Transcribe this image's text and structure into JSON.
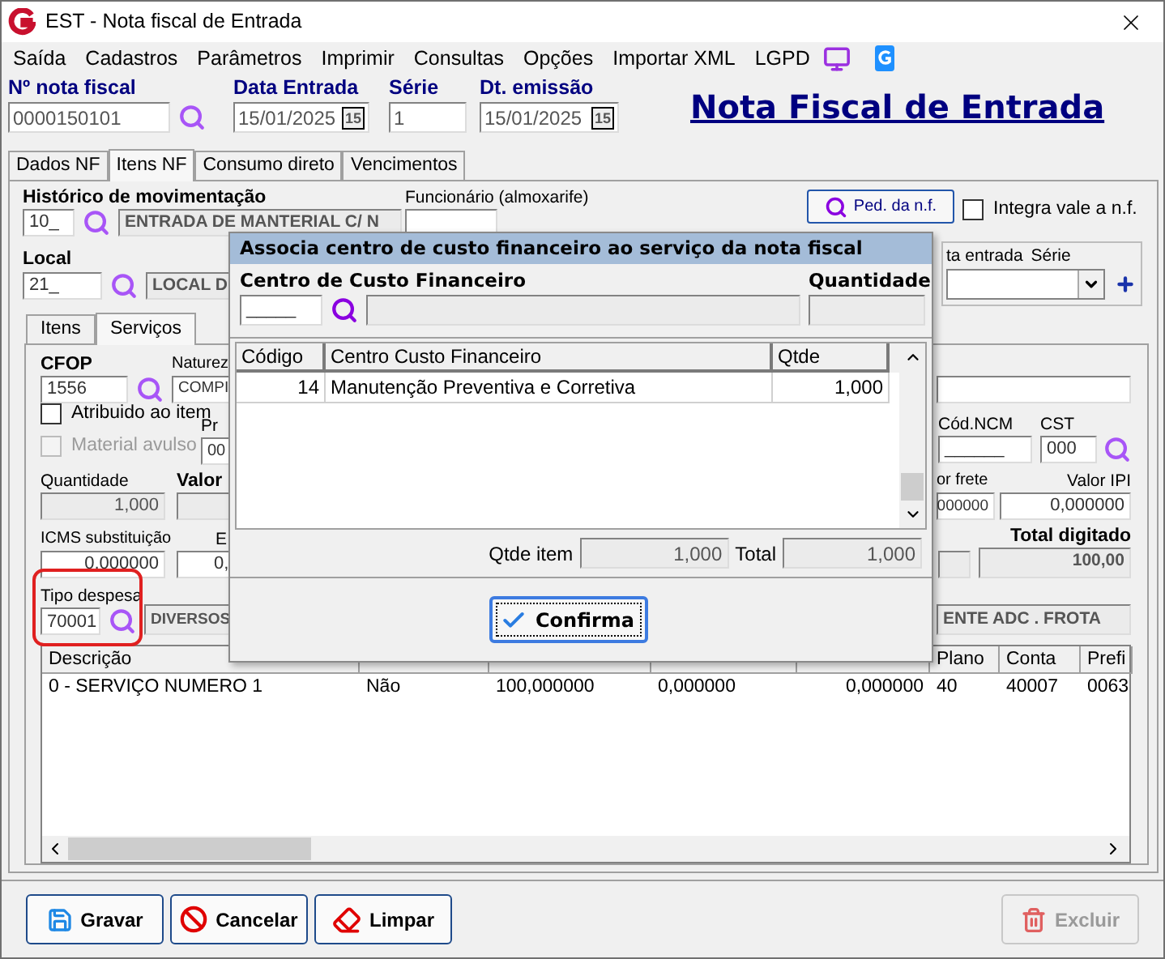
{
  "window": {
    "title": "EST - Nota fiscal de Entrada"
  },
  "menu": [
    "Saída",
    "Cadastros",
    "Parâmetros",
    "Imprimir",
    "Consultas",
    "Opções",
    "Importar XML",
    "LGPD"
  ],
  "header": {
    "fields": [
      {
        "label": "Nº nota fiscal",
        "value": "0000150101",
        "kind": "lookup"
      },
      {
        "label": "Data Entrada",
        "value": "15/01/2025",
        "kind": "date",
        "calendar": "15"
      },
      {
        "label": "Série",
        "value": "1",
        "kind": "text"
      },
      {
        "label": "Dt. emissão",
        "value": "15/01/2025",
        "kind": "date",
        "calendar": "15"
      }
    ],
    "title": "Nota Fiscal de Entrada"
  },
  "tabs": [
    {
      "label": "Dados NF",
      "selected": false
    },
    {
      "label": "Itens NF",
      "selected": true
    },
    {
      "label": "Consumo direto",
      "selected": false
    },
    {
      "label": "Vencimentos",
      "selected": false
    }
  ],
  "historico": {
    "label": "Histórico de movimentação",
    "code": "10_",
    "description": "ENTRADA DE MANTERIAL C/ N"
  },
  "funcionario": {
    "label": "Funcionário (almoxarife)"
  },
  "ped_button": "Ped. da n.f.",
  "integra": {
    "label": "Integra vale a n.f.",
    "checked": false
  },
  "local": {
    "label": "Local",
    "code": "21_",
    "description": "LOCAL D"
  },
  "nota_entrada": {
    "label": "ta entrada",
    "serie_label": "Série"
  },
  "subtabs": [
    {
      "label": "Itens",
      "selected": false
    },
    {
      "label": "Serviços",
      "selected": true
    }
  ],
  "servicos": {
    "cfop": {
      "label": "CFOP",
      "value": "1556"
    },
    "natureza": {
      "label": "Naturez",
      "value": "COMPI"
    },
    "atribuido": {
      "label": "Atribuido ao item",
      "checked": false,
      "disabled": false
    },
    "material_avulso": {
      "label": "Material avulso",
      "checked": false,
      "disabled": true
    },
    "pr": {
      "label": "Pr",
      "value": "00"
    },
    "ncm": {
      "label": "Cód.NCM",
      "value": "______"
    },
    "cst": {
      "label": "CST",
      "value": "000"
    },
    "quantidade": {
      "label": "Quantidade",
      "value": "1,000"
    },
    "valor": {
      "label": "Valor"
    },
    "frete": {
      "label": "or frete",
      "value": "000000"
    },
    "ipi": {
      "label": "Valor IPI",
      "value": "0,000000"
    },
    "icms": {
      "label": "ICMS substituição",
      "value": "0,000000"
    },
    "e": {
      "label": "E",
      "value": "0,"
    },
    "total": {
      "label": "Total digitado",
      "value": "100,00"
    },
    "tipo_despesa": {
      "label": "Tipo despesa",
      "value": "70001",
      "description": "DIVERSOS"
    },
    "conta_desc": "ENTE ADC . FROTA",
    "table": {
      "columns": [
        {
          "heading": "Descrição"
        },
        {},
        {},
        {},
        {},
        {
          "heading": "Plano"
        },
        {
          "heading": "Conta"
        },
        {
          "heading": "Prefi"
        }
      ],
      "rows": [
        [
          "0 - SERVIÇO NUMERO 1",
          "Não",
          "100,000000",
          "0,000000",
          "0,000000",
          "40",
          "40007",
          "0063"
        ]
      ]
    }
  },
  "dialog": {
    "title": "Associa centro de custo financeiro ao serviço da nota fiscal",
    "centro_label": "Centro de Custo Financeiro",
    "centro_value": "_____",
    "quantidade_label": "Quantidade",
    "table": {
      "columns": [
        "Código",
        "Centro Custo Financeiro",
        "Qtde"
      ],
      "rows": [
        [
          "14",
          "Manutenção Preventiva e Corretiva",
          "1,000"
        ]
      ]
    },
    "qtde_item_label": "Qtde item",
    "qtde_item": "1,000",
    "total_label": "Total",
    "total": "1,000",
    "confirm": "Confirma"
  },
  "buttons": [
    {
      "label": "Gravar",
      "kind": "save",
      "disabled": false
    },
    {
      "label": "Cancelar",
      "kind": "cancel",
      "disabled": false
    },
    {
      "label": "Limpar",
      "kind": "clear",
      "disabled": false
    },
    {
      "label": "Excluir",
      "kind": "delete",
      "disabled": true
    }
  ]
}
